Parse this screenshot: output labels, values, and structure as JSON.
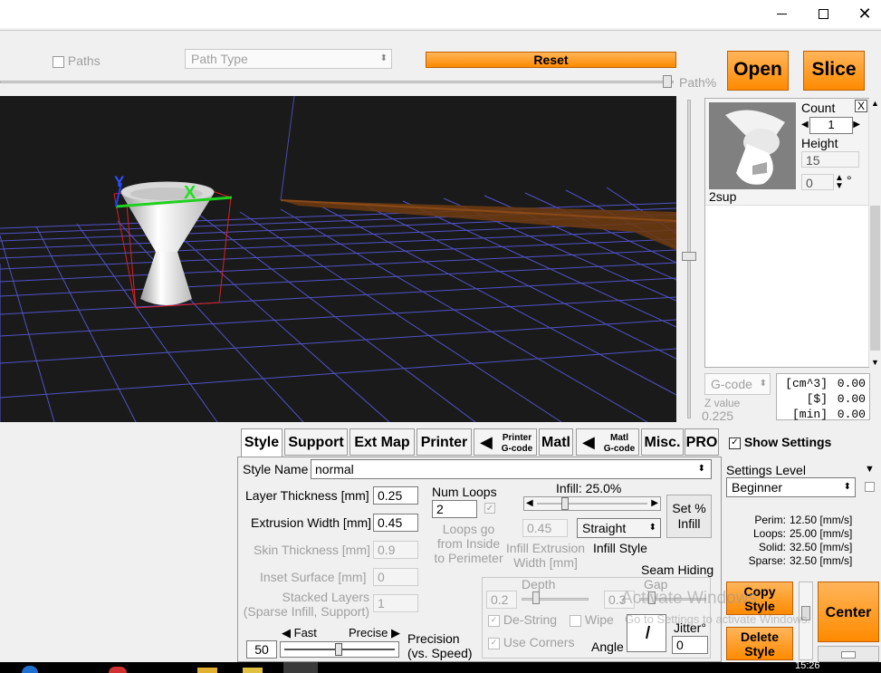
{
  "toolbar": {
    "paths_label": "Paths",
    "path_type_placeholder": "Path Type",
    "reset_label": "Reset",
    "open_label": "Open",
    "slice_label": "Slice",
    "path_percent_label": "Path%"
  },
  "model_panel": {
    "close_label": "X",
    "count_label": "Count",
    "count_value": "1",
    "height_label": "Height",
    "height_value": "15",
    "rotation_value": "0",
    "degree_symbol": "°",
    "model_name": "2sup"
  },
  "gcode_panel": {
    "gcode_label": "G-code",
    "z_value_label": "Z value",
    "z_value": "0.225",
    "stats": [
      {
        "unit": "[cm^3]",
        "value": "0.00"
      },
      {
        "unit": "[$]",
        "value": "0.00"
      },
      {
        "unit": "[min]",
        "value": "0.00"
      }
    ]
  },
  "viewport": {
    "axis_y": "Y",
    "axis_x": "X"
  },
  "tabs": [
    {
      "label": "Style"
    },
    {
      "label": "Support"
    },
    {
      "label": "Ext Map"
    },
    {
      "label": "Printer"
    },
    {
      "label_top": "Printer",
      "label_bottom": "G-code"
    },
    {
      "label": "Matl"
    },
    {
      "label_top": "Matl",
      "label_bottom": "G-code"
    },
    {
      "label": "Misc."
    },
    {
      "label": "PRO"
    }
  ],
  "style": {
    "style_name_label": "Style Name",
    "style_name_value": "normal",
    "layer_thickness_label": "Layer Thickness [mm]",
    "layer_thickness_value": "0.25",
    "extrusion_width_label": "Extrusion Width [mm]",
    "extrusion_width_value": "0.45",
    "skin_thickness_label": "Skin Thickness [mm]",
    "skin_thickness_value": "0.9",
    "inset_surface_label": "Inset  Surface [mm]",
    "inset_surface_value": "0",
    "stacked_layers_label_1": "Stacked Layers",
    "stacked_layers_label_2": "(Sparse Infill, Support)",
    "stacked_layers_value": "1",
    "num_loops_label": "Num Loops",
    "num_loops_value": "2",
    "loops_go_1": "Loops go",
    "loops_go_2": "from Inside",
    "loops_go_3": "to Perimeter",
    "infill_label": "Infill: 25.0%",
    "infill_percent": 25,
    "set_percent_1": "Set %",
    "set_percent_2": "Infill",
    "infill_extrusion_value": "0.45",
    "infill_extrusion_label_1": "Infill Extrusion",
    "infill_extrusion_label_2": "Width [mm]",
    "infill_style_value": "Straight",
    "infill_style_label": "Infill Style",
    "seam_hiding_label": "Seam Hiding",
    "depth_label": "Depth",
    "depth_value": "0.2",
    "gap_label": "Gap",
    "gap_value": "0.3",
    "destring_label": "De-String",
    "wipe_label": "Wipe",
    "use_corners_label": "Use Corners",
    "angle_label": "Angle",
    "jitter_label": "Jitter°",
    "jitter_value": "0",
    "precision_value": "50",
    "fast_label": "Fast",
    "precise_label": "Precise",
    "precision_label_1": "Precision",
    "precision_label_2": "(vs. Speed)"
  },
  "settings": {
    "show_settings_label": "Show Settings",
    "settings_level_label": "Settings Level",
    "settings_level_value": "Beginner",
    "speeds": [
      {
        "name": "Perim:",
        "value": "12.50 [mm/s]"
      },
      {
        "name": "Loops:",
        "value": "25.00 [mm/s]"
      },
      {
        "name": "Solid:",
        "value": "32.50 [mm/s]"
      },
      {
        "name": "Sparse:",
        "value": "32.50 [mm/s]"
      }
    ],
    "copy_style_1": "Copy",
    "copy_style_2": "Style",
    "delete_style_1": "Delete",
    "delete_style_2": "Style",
    "center_label": "Center"
  },
  "watermark": {
    "line1": "Activate Windows",
    "line2": "Go to Settings to activate Windows."
  },
  "taskbar": {
    "clock": "15:26"
  }
}
